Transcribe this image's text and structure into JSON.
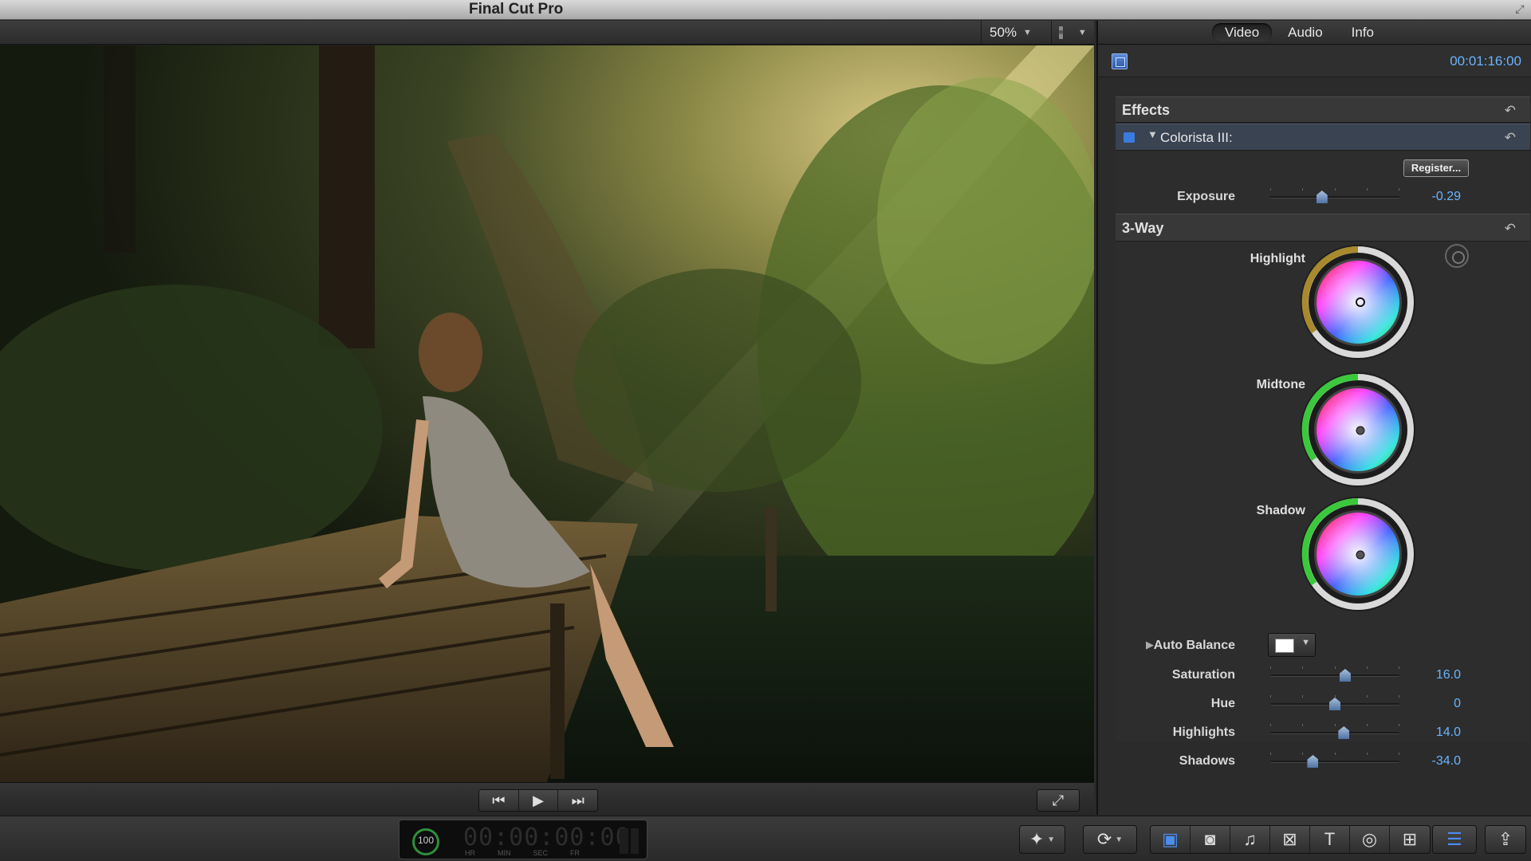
{
  "app": {
    "title": "Final Cut Pro"
  },
  "viewer": {
    "zoom": "50%",
    "transport": {
      "prev_icon": "go-to-start-icon",
      "play_icon": "play-icon",
      "next_icon": "go-to-end-icon"
    },
    "fullscreen_icon": "fullscreen-icon"
  },
  "inspector": {
    "tabs": [
      {
        "label": "Video",
        "active": true
      },
      {
        "label": "Audio",
        "active": false
      },
      {
        "label": "Info",
        "active": false
      }
    ],
    "timecode": "00:01:16:00",
    "effects_header": "Effects",
    "effect_name": "Colorista III:",
    "register_button": "Register...",
    "exposure": {
      "label": "Exposure",
      "value": "-0.29",
      "fraction": 0.4
    },
    "threeway_header": "3-Way",
    "wheels": [
      {
        "label": "Highlight"
      },
      {
        "label": "Midtone"
      },
      {
        "label": "Shadow"
      }
    ],
    "auto_balance": {
      "label": "Auto Balance"
    },
    "sliders": [
      {
        "label": "Saturation",
        "value": "16.0",
        "fraction": 0.58
      },
      {
        "label": "Hue",
        "value": "0",
        "fraction": 0.5
      },
      {
        "label": "Highlights",
        "value": "14.0",
        "fraction": 0.57
      },
      {
        "label": "Shadows",
        "value": "-34.0",
        "fraction": 0.33
      }
    ]
  },
  "dashboard": {
    "percent": "100",
    "timecode": "00:00:00:00",
    "units": [
      "HR",
      "MIN",
      "SEC",
      "FR"
    ]
  },
  "toolbar": {
    "icons": [
      "magic-wand-icon",
      "retime-icon",
      "event-browser-icon",
      "photo-browser-icon",
      "music-browser-icon",
      "transitions-browser-icon",
      "titles-browser-icon",
      "generators-browser-icon",
      "themes-browser-icon",
      "inspector-icon",
      "share-icon"
    ]
  },
  "colors": {
    "accent": "#6ab4ff",
    "selection": "#3a7be0"
  }
}
